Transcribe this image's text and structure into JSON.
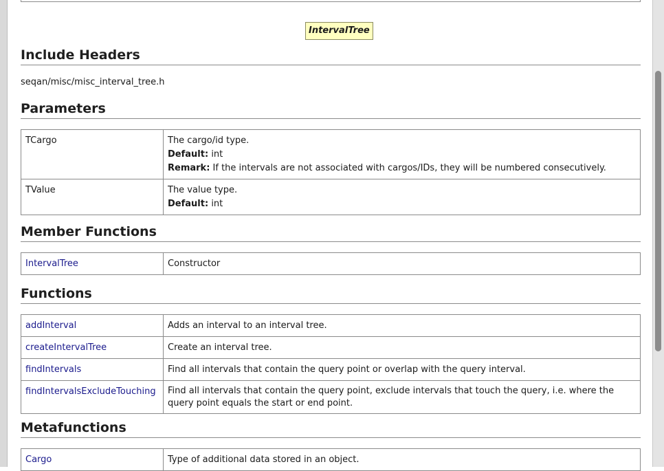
{
  "class_badge": "IntervalTree",
  "sections": {
    "include_headers": "Include Headers",
    "parameters": "Parameters",
    "member_functions": "Member Functions",
    "functions": "Functions",
    "metafunctions": "Metafunctions"
  },
  "include_header_path": "seqan/misc/misc_interval_tree.h",
  "parameters": [
    {
      "name": "TCargo",
      "desc": "The cargo/id type.",
      "default_label": "Default:",
      "default_value": "int",
      "remark_label": "Remark:",
      "remark": "If the intervals are not associated with cargos/IDs, they will be numbered consecutively."
    },
    {
      "name": "TValue",
      "desc": "The value type.",
      "default_label": "Default:",
      "default_value": "int"
    }
  ],
  "member_functions": [
    {
      "name": "IntervalTree",
      "desc": "Constructor"
    }
  ],
  "functions": [
    {
      "name": "addInterval",
      "desc": "Adds an interval to an interval tree."
    },
    {
      "name": "createIntervalTree",
      "desc": "Create an interval tree."
    },
    {
      "name": "findIntervals",
      "desc": "Find all intervals that contain the query point or overlap with the query interval."
    },
    {
      "name": "findIntervalsExcludeTouching",
      "desc": "Find all intervals that contain the query point, exclude intervals that touch the query, i.e. where the query point equals the start or end point."
    }
  ],
  "metafunctions": [
    {
      "name": "Cargo",
      "desc": "Type of additional data stored in an object."
    }
  ]
}
